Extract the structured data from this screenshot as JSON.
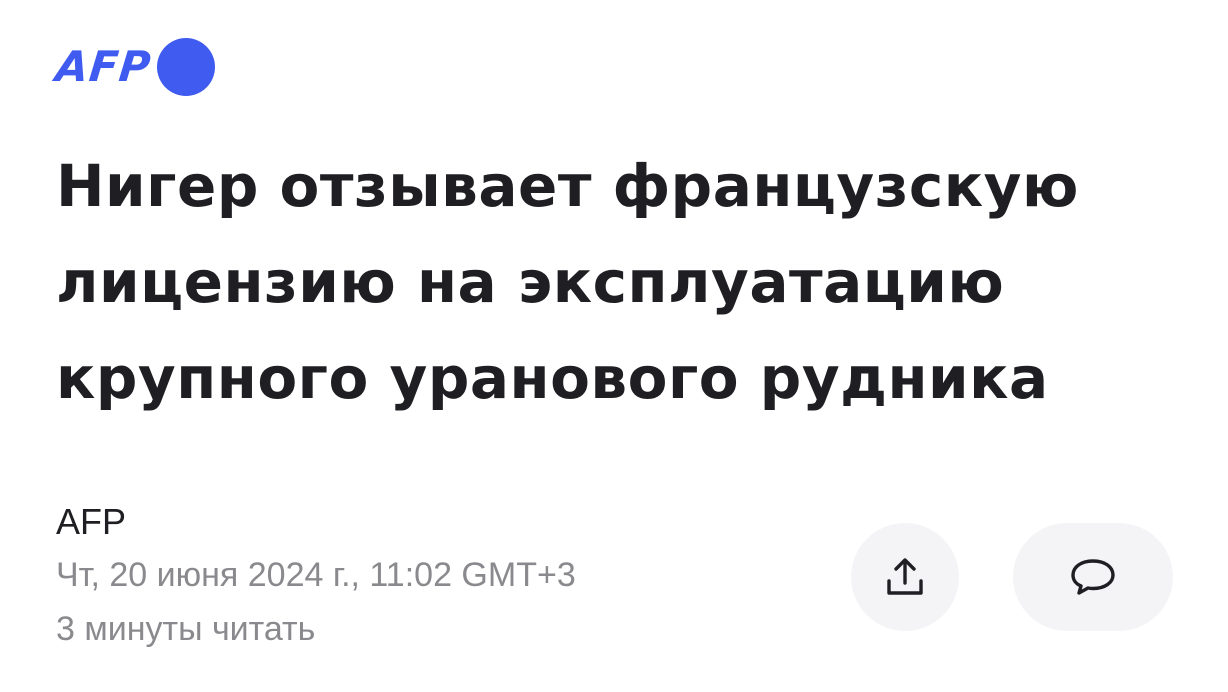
{
  "logo": {
    "text": "AFP",
    "color": "#3f5bf0"
  },
  "article": {
    "headline": "Нигер отзывает французскую лицензию на эксплуатацию крупного уранового рудника",
    "source": "AFP",
    "date": "Чт, 20 июня 2024 г., 11:02 GMT+3",
    "read_time": "3 минуты читать"
  },
  "actions": {
    "share_icon": "share-icon",
    "comment_icon": "comment-icon"
  }
}
